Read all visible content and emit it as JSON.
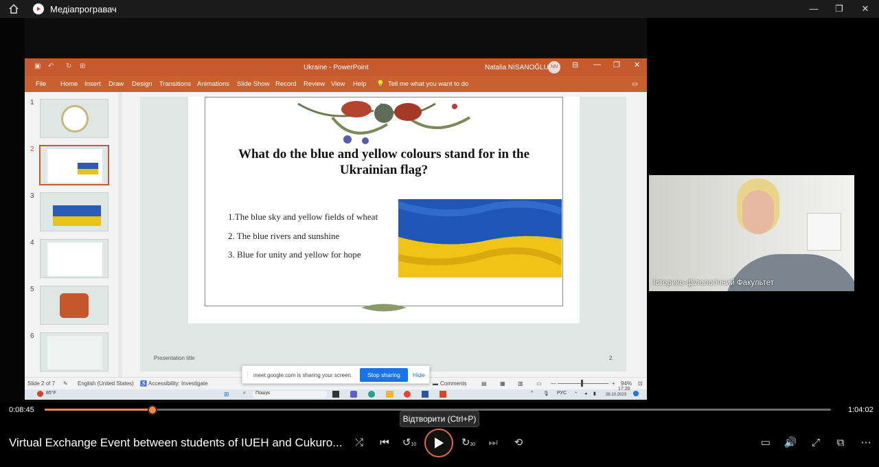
{
  "window": {
    "title": "Медіапрогравач"
  },
  "powerpoint": {
    "doc_title": "Ukraine - PowerPoint",
    "user_name": "Natalia NİSANOĞLU",
    "user_initials": "NN",
    "tabs": [
      "File",
      "Home",
      "Insert",
      "Draw",
      "Design",
      "Transitions",
      "Animations",
      "Slide Show",
      "Record",
      "Review",
      "View",
      "Help"
    ],
    "tell_me": "Tell me what you want to do",
    "thumb_numbers": [
      "1",
      "2",
      "3",
      "4",
      "5",
      "6"
    ],
    "slide": {
      "title": "What do the blue and yellow colours stand for in the Ukrainian flag?",
      "bullets": [
        "1.The blue sky and yellow fields of wheat",
        "2. The blue rivers and sunshine",
        "3. Blue for unity and yellow for hope"
      ],
      "footer_title": "Presentation title",
      "page_number": "2"
    },
    "status": {
      "slide_of": "Slide 2 of 7",
      "language": "English (United States)",
      "accessibility": "Accessibility: Investigate",
      "comments": "Comments",
      "zoom": "94%"
    },
    "sharing": {
      "message": "meet.google.com is sharing your screen.",
      "stop_label": "Stop sharing",
      "hide_label": "Hide"
    },
    "taskbar": {
      "weather": "85°F",
      "search": "Пошук",
      "lang": "РУС",
      "time": "17:20",
      "date": "26.10.2023"
    }
  },
  "webcam": {
    "label": "Історико-філологічний Факультет"
  },
  "player": {
    "elapsed": "0:08:45",
    "duration": "1:04:02",
    "progress_fraction": 0.137,
    "tooltip": "Відтворити (Ctrl+P)",
    "video_title": "Virtual Exchange Event between students of IUEH and Cukuro...",
    "skip_back_seconds": "10",
    "skip_forward_seconds": "30",
    "accent_color": "#f08a4b"
  }
}
